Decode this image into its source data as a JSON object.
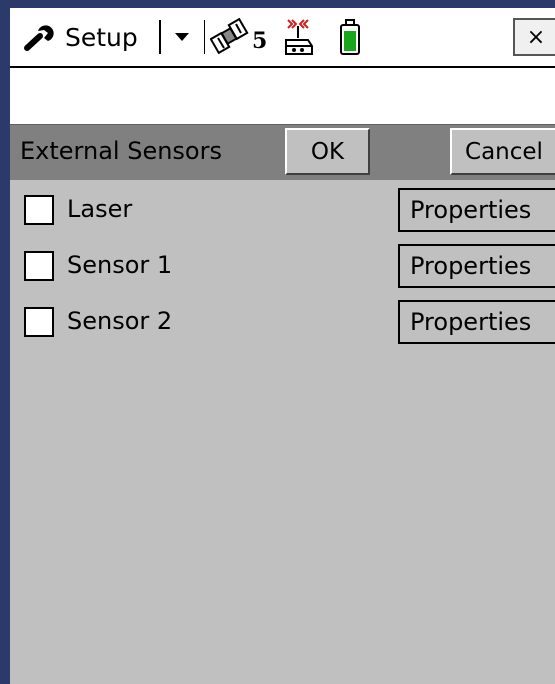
{
  "titlebar": {
    "menu_label": "Setup",
    "satellite_count": "5",
    "close_label": "×",
    "icons": [
      "wrench-icon",
      "dropdown-arrow-icon",
      "satellite-icon",
      "radio-icon",
      "battery-icon"
    ]
  },
  "form": {
    "title": "External Sensors",
    "ok_label": "OK",
    "cancel_label": "Cancel"
  },
  "sensors": [
    {
      "label": "Laser",
      "checked": false,
      "button_label": "Properties"
    },
    {
      "label": "Sensor 1",
      "checked": false,
      "button_label": "Properties"
    },
    {
      "label": "Sensor 2",
      "checked": false,
      "button_label": "Properties"
    }
  ],
  "colors": {
    "background": "#c0c0c0",
    "header": "#808080",
    "battery_fill": "#1aa61a",
    "radio_signal": "#d02020"
  }
}
